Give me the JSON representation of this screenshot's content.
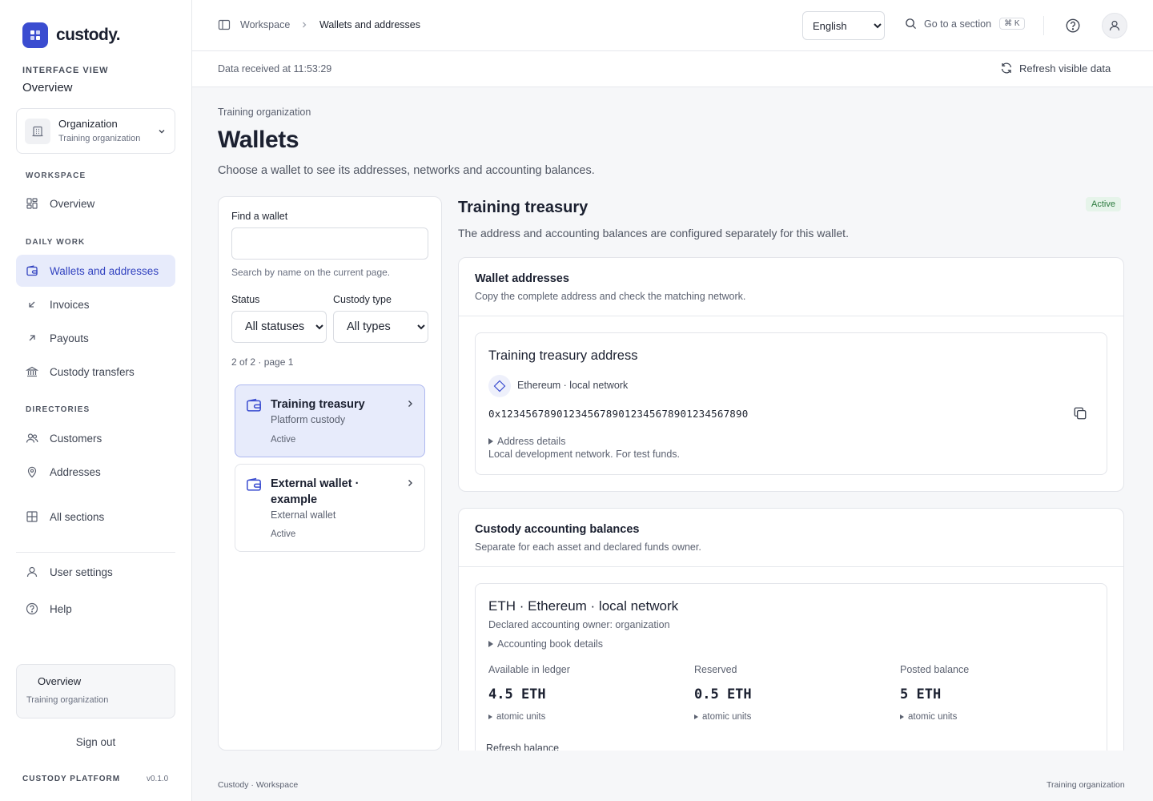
{
  "brand": {
    "name": "custody."
  },
  "sidebar": {
    "interface_view_label": "INTERFACE VIEW",
    "interface_view_value": "Overview",
    "org_switcher": {
      "title": "Organization",
      "subtitle": "Training organization"
    },
    "sections": {
      "workspace": "WORKSPACE",
      "daily_work": "DAILY WORK",
      "directories": "DIRECTORIES"
    },
    "items": {
      "overview": "Overview",
      "wallets": "Wallets and addresses",
      "invoices": "Invoices",
      "payouts": "Payouts",
      "transfers": "Custody transfers",
      "customers": "Customers",
      "addresses": "Addresses",
      "all_sections": "All sections",
      "user_settings": "User settings",
      "help": "Help"
    },
    "context_card": {
      "title": "Overview",
      "subtitle": "Training organization"
    },
    "sign_out": "Sign out",
    "platform": "CUSTODY PLATFORM",
    "version": "v0.1.0"
  },
  "topbar": {
    "breadcrumb": [
      "Workspace",
      "Wallets and addresses"
    ],
    "language": {
      "selected": "English"
    },
    "goto": {
      "label": "Go to a section",
      "shortcut": "⌘ K"
    }
  },
  "statusbar": {
    "received": "Data received at 11:53:29",
    "refresh": "Refresh visible data"
  },
  "page": {
    "org_crumb": "Training organization",
    "title": "Wallets",
    "description": "Choose a wallet to see its addresses, networks and accounting balances."
  },
  "filters": {
    "find_label": "Find a wallet",
    "find_value": "",
    "find_hint": "Search by name on the current page.",
    "status_label": "Status",
    "status_selected": "All statuses",
    "type_label": "Custody type",
    "type_selected": "All types",
    "count": "2 of 2 · page 1"
  },
  "wallets": [
    {
      "name": "Training treasury",
      "type": "Platform custody",
      "status": "Active"
    },
    {
      "name": "External wallet · example",
      "type": "External wallet",
      "status": "Active"
    }
  ],
  "detail": {
    "title": "Training treasury",
    "status": "Active",
    "description": "The address and accounting balances are configured separately for this wallet.",
    "addresses_card": {
      "title": "Wallet addresses",
      "subtitle": "Copy the complete address and check the matching network.",
      "address": {
        "title": "Training treasury address",
        "network": "Ethereum · local network",
        "value": "0x1234567890123456789012345678901234567890",
        "details_toggle": "Address details",
        "note": "Local development network. For test funds."
      }
    },
    "balances_card": {
      "title": "Custody accounting balances",
      "subtitle": "Separate for each asset and declared funds owner.",
      "asset": {
        "title": "ETH · Ethereum · local network",
        "owner": "Declared accounting owner: organization",
        "book_toggle": "Accounting book details",
        "columns": [
          {
            "label": "Available in ledger",
            "value": "4.5 ETH",
            "units": "atomic units"
          },
          {
            "label": "Reserved",
            "value": "0.5 ETH",
            "units": "atomic units"
          },
          {
            "label": "Posted balance",
            "value": "5 ETH",
            "units": "atomic units"
          }
        ],
        "refresh": "Refresh balance"
      }
    }
  },
  "footer": {
    "left": "Custody · Workspace",
    "right": "Training organization"
  },
  "colors": {
    "accent": "#3a4cd0",
    "active_nav_bg": "#e7ebfb",
    "status_green": "#2b7a3d"
  }
}
